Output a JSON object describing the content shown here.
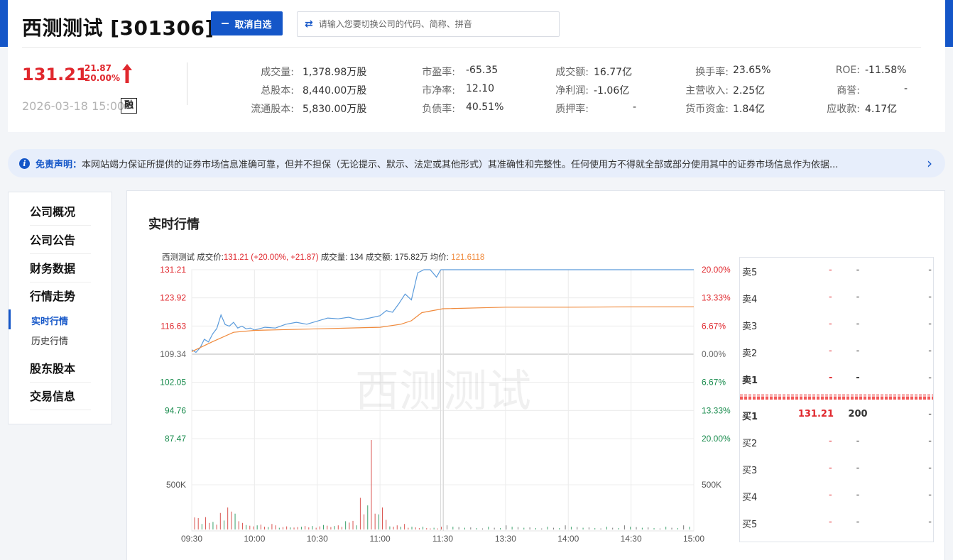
{
  "header": {
    "title": "西测测试 [301306]",
    "fav_button": "取消自选",
    "search_placeholder": "请输入您要切换公司的代码、简称、拼音",
    "price": "131.21",
    "change": "21.87",
    "change_pct": "20.00%",
    "datetime": "2026-03-18 15:00",
    "margin_badge": "融"
  },
  "stats": [
    {
      "label": "成交量:",
      "value": "1,378.98万股"
    },
    {
      "label": "总股本:",
      "value": "8,440.00万股"
    },
    {
      "label": "流通股本:",
      "value": "5,830.00万股"
    },
    {
      "label": "市盈率:",
      "value": "-65.35"
    },
    {
      "label": "市净率:",
      "value": "12.10"
    },
    {
      "label": "负债率:",
      "value": "40.51%"
    },
    {
      "label": "成交额:",
      "value": "16.77亿"
    },
    {
      "label": "净利润:",
      "value": "-1.06亿"
    },
    {
      "label": "质押率:",
      "value": "-"
    },
    {
      "label": "换手率:",
      "value": "23.65%"
    },
    {
      "label": "主营收入:",
      "value": "2.25亿"
    },
    {
      "label": "货币资金:",
      "value": "1.84亿"
    },
    {
      "label": "ROE:",
      "value": "-11.58%"
    },
    {
      "label": "商誉:",
      "value": "-"
    },
    {
      "label": "应收款:",
      "value": "4.17亿"
    }
  ],
  "notice": {
    "label": "免责声明：",
    "text": "本网站竭力保证所提供的证券市场信息准确可靠，但并不担保（无论提示、默示、法定或其他形式）其准确性和完整性。任何使用方不得就全部或部分使用其中的证券市场信息作为依据..."
  },
  "sidebar": {
    "items": [
      "公司概况",
      "公司公告",
      "财务数据",
      "行情走势"
    ],
    "sub_items": [
      "实时行情",
      "历史行情"
    ],
    "items2": [
      "股东股本",
      "交易信息"
    ]
  },
  "section_title": "实时行情",
  "chart_data": {
    "type": "line",
    "info": {
      "name": "西测测试",
      "price_label": "成交价:",
      "price_value": "131.21 (+20.00%, +21.87)",
      "vol_label": "成交量:",
      "vol_value": "134",
      "amt_label": "成交额:",
      "amt_value": "175.82万",
      "avg_label": "均价:",
      "avg_value": "121.6118"
    },
    "watermark": "西测测试",
    "left_ticks": [
      "131.21",
      "123.92",
      "116.63",
      "109.34",
      "102.05",
      "94.76",
      "87.47"
    ],
    "right_ticks": [
      "20.00%",
      "13.33%",
      "6.67%",
      "0.00%",
      "6.67%",
      "13.33%",
      "20.00%"
    ],
    "volume_tick": "500K",
    "x_labels": [
      "09:30",
      "10:00",
      "10:30",
      "11:00",
      "11:30",
      "13:30",
      "14:00",
      "14:30",
      "15:00"
    ],
    "ylim": [
      87.47,
      131.21
    ],
    "prev_close": 109.34,
    "series": [
      {
        "name": "成交价",
        "x": [
          "09:30",
          "09:32",
          "09:34",
          "09:36",
          "09:38",
          "09:40",
          "09:42",
          "09:44",
          "09:46",
          "09:48",
          "09:50",
          "09:52",
          "09:54",
          "09:56",
          "09:58",
          "10:00",
          "10:05",
          "10:10",
          "10:15",
          "10:20",
          "10:25",
          "10:30",
          "10:35",
          "10:40",
          "10:45",
          "10:50",
          "10:55",
          "11:00",
          "11:03",
          "11:06",
          "11:09",
          "11:12",
          "11:15",
          "11:18",
          "11:21",
          "11:24",
          "11:27",
          "11:29",
          "11:30",
          "13:30",
          "14:00",
          "14:30",
          "15:00"
        ],
        "values": [
          110.5,
          109.8,
          111.0,
          113.2,
          112.5,
          114.6,
          116.0,
          119.5,
          117.0,
          116.6,
          117.6,
          116.1,
          116.6,
          115.9,
          116.1,
          115.6,
          116.3,
          116.1,
          117.1,
          117.6,
          117.1,
          117.9,
          118.7,
          118.5,
          118.9,
          118.2,
          118.7,
          119.3,
          120.6,
          120.2,
          122.4,
          124.9,
          123.4,
          130.4,
          131.21,
          131.21,
          129.3,
          131.21,
          131.21,
          131.21,
          131.21,
          131.21,
          131.21
        ]
      },
      {
        "name": "均价",
        "x": [
          "09:30",
          "09:40",
          "09:50",
          "10:00",
          "10:30",
          "11:00",
          "11:10",
          "11:15",
          "11:20",
          "11:30",
          "13:30",
          "14:00",
          "14:30",
          "15:00"
        ],
        "values": [
          110.0,
          112.6,
          115.0,
          115.5,
          115.9,
          116.3,
          117.1,
          118.0,
          120.1,
          121.1,
          121.5,
          121.5,
          121.6,
          121.61
        ]
      }
    ],
    "volume": {
      "x_start": "09:30",
      "x_end": "15:00",
      "values": [
        175,
        165,
        80,
        180,
        95,
        110,
        70,
        240,
        130,
        320,
        260,
        230,
        120,
        95,
        65,
        55,
        45,
        60,
        70,
        40,
        35,
        80,
        60,
        25,
        35,
        45,
        30,
        28,
        35,
        40,
        50,
        30,
        50,
        25,
        45,
        65,
        55,
        35,
        50,
        60,
        38,
        120,
        100,
        125,
        60,
        460,
        220,
        350,
        1300,
        230,
        220,
        320,
        140,
        45,
        40,
        60,
        40,
        80,
        25,
        40,
        30,
        20,
        40,
        20,
        15,
        25,
        15,
        40
      ]
    }
  },
  "order_book": {
    "asks": [
      {
        "label": "卖5",
        "price": "-",
        "vol": "-",
        "extra": "-"
      },
      {
        "label": "卖4",
        "price": "-",
        "vol": "-",
        "extra": "-"
      },
      {
        "label": "卖3",
        "price": "-",
        "vol": "-",
        "extra": "-"
      },
      {
        "label": "卖2",
        "price": "-",
        "vol": "-",
        "extra": "-"
      },
      {
        "label": "卖1",
        "price": "-",
        "vol": "-",
        "extra": "-"
      }
    ],
    "bids": [
      {
        "label": "买1",
        "price": "131.21",
        "vol": "200",
        "extra": "-"
      },
      {
        "label": "买2",
        "price": "-",
        "vol": "-",
        "extra": "-"
      },
      {
        "label": "买3",
        "price": "-",
        "vol": "-",
        "extra": "-"
      },
      {
        "label": "买4",
        "price": "-",
        "vol": "-",
        "extra": "-"
      },
      {
        "label": "买5",
        "price": "-",
        "vol": "-",
        "extra": "-"
      }
    ]
  },
  "colors": {
    "brand": "#1456c8",
    "up": "#e0282e",
    "down": "#1a8c4e",
    "price_line": "#5b9bdb",
    "avg_line": "#f08a3c"
  }
}
